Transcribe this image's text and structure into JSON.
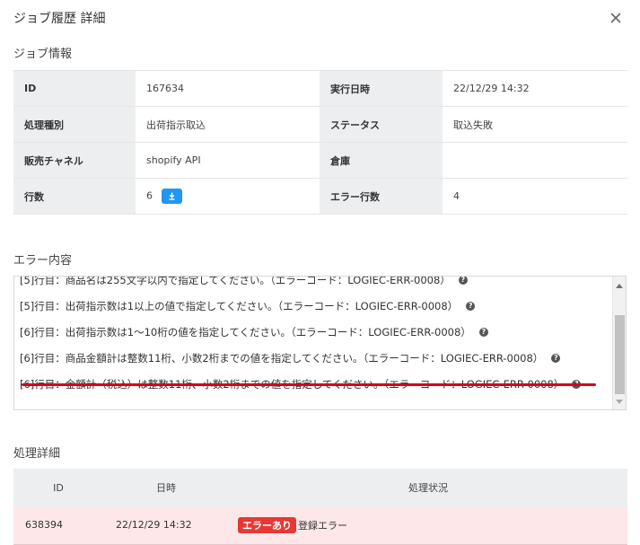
{
  "modal": {
    "title": "ジョブ履歴 詳細"
  },
  "job_info": {
    "section_label": "ジョブ情報",
    "rows": [
      [
        {
          "key": "ID",
          "value": "167634"
        },
        {
          "key": "実行日時",
          "value": "22/12/29 14:32"
        }
      ],
      [
        {
          "key": "処理種別",
          "value": "出荷指示取込"
        },
        {
          "key": "ステータス",
          "value": "取込失敗"
        }
      ],
      [
        {
          "key": "販売チャネル",
          "value": "shopify API"
        },
        {
          "key": "倉庫",
          "value": ""
        }
      ],
      [
        {
          "key": "行数",
          "value": "6"
        },
        {
          "key": "エラー行数",
          "value": "4"
        }
      ]
    ]
  },
  "errors": {
    "section_label": "エラー内容",
    "lines": [
      "[5]行目：商品名は255文字以内で指定してください。（エラーコード：LOGIEC-ERR-0008）",
      "[5]行目：出荷指示数は1以上の値で指定してください。（エラーコード：LOGIEC-ERR-0008）",
      "[6]行目：出荷指示数は1〜10桁の値を指定してください。（エラーコード：LOGIEC-ERR-0008）",
      "[6]行目：商品金額計は整数11桁、小数2桁までの値を指定してください。（エラーコード：LOGIEC-ERR-0008）",
      "[6]行目：金額計（税込）は整数11桁、小数2桁までの値を指定してください。（エラーコード：LOGIEC-ERR-0008）"
    ],
    "highlight_color": "#d7001a"
  },
  "process": {
    "section_label": "処理詳細",
    "headers": [
      "ID",
      "日時",
      "処理状況"
    ],
    "rows": [
      {
        "id": "638394",
        "datetime": "22/12/29 14:32",
        "badge": "エラーあり",
        "status": "登録エラー"
      }
    ]
  },
  "colors": {
    "accent": "#2196f3",
    "error_badge": "#e53935",
    "error_row": "#fde7e9"
  }
}
